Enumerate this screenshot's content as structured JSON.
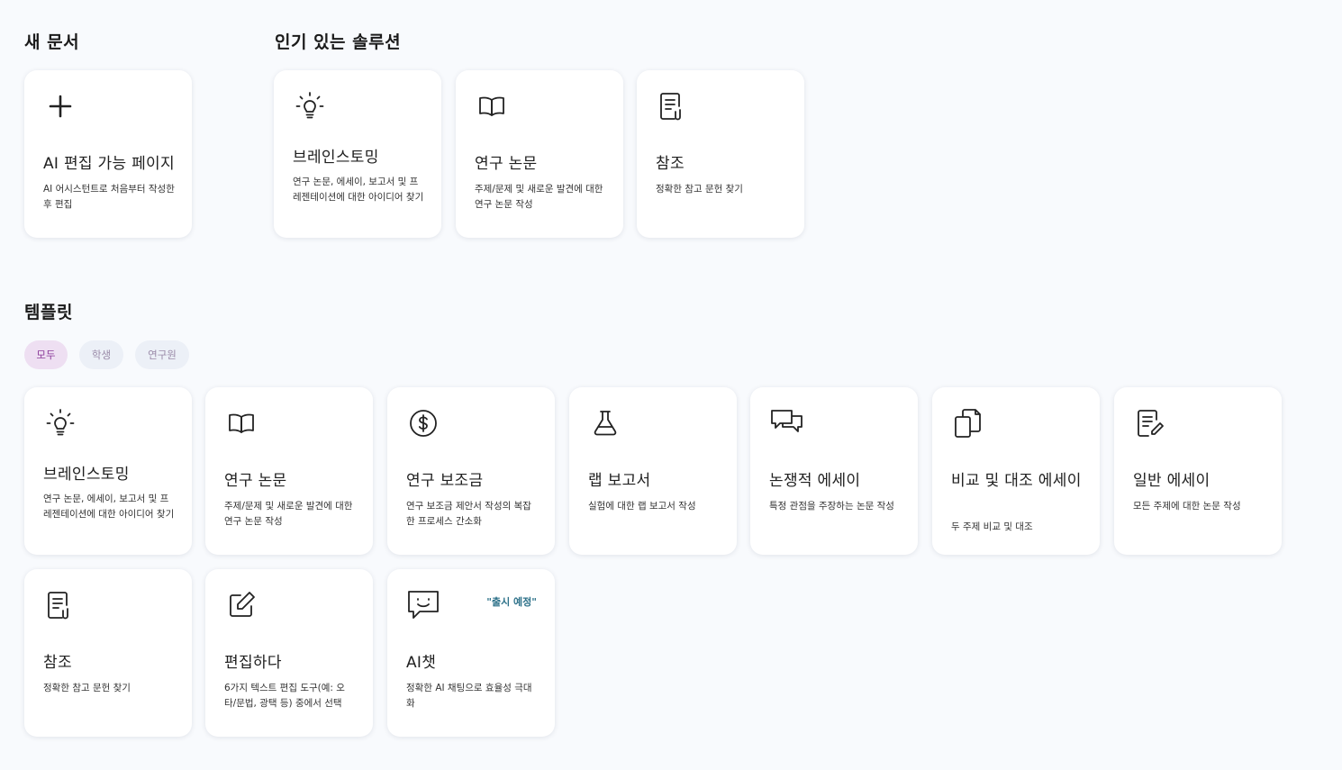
{
  "sections": {
    "new_doc": "새 문서",
    "popular": "인기 있는 솔루션",
    "templates": "템플릿"
  },
  "new_doc_card": {
    "icon": "plus-icon",
    "title": "AI 편집 가능 페이지",
    "desc": "AI 어시스턴트로 처음부터 작성한 후 편집"
  },
  "popular_cards": [
    {
      "icon": "lightbulb-icon",
      "title": "브레인스토밍",
      "desc": "연구 논문, 에세이, 보고서 및 프레젠테이션에 대한 아이디어 찾기"
    },
    {
      "icon": "book-icon",
      "title": "연구 논문",
      "desc": "주제/문제 및 새로운 발견에 대한 연구 논문 작성"
    },
    {
      "icon": "document-clip-icon",
      "title": "참조",
      "desc": "정확한 참고 문헌 찾기"
    }
  ],
  "filters": [
    "모두",
    "학생",
    "연구원"
  ],
  "template_cards": [
    {
      "icon": "lightbulb-icon",
      "title": "브레인스토밍",
      "desc": "연구 논문, 에세이, 보고서 및 프레젠테이션에 대한 아이디어 찾기"
    },
    {
      "icon": "book-icon",
      "title": "연구 논문",
      "desc": "주제/문제 및 새로운 발견에 대한 연구 논문 작성"
    },
    {
      "icon": "dollar-icon",
      "title": "연구 보조금",
      "desc": "연구 보조금 제안서 작성의 복잡한 프로세스 간소화"
    },
    {
      "icon": "flask-icon",
      "title": "랩 보고서",
      "desc": "실험에 대한 랩 보고서 작성"
    },
    {
      "icon": "chat-bubbles-icon",
      "title": "논쟁적 에세이",
      "desc": "특정 관점을 주장하는 논문 작성"
    },
    {
      "icon": "copy-icon",
      "title": "비교 및 대조 에세이",
      "desc": "두 주제 비교 및 대조"
    },
    {
      "icon": "document-edit-icon",
      "title": "일반 에세이",
      "desc": "모든 주제에 대한 논문 작성"
    },
    {
      "icon": "document-clip-icon",
      "title": "참조",
      "desc": "정확한 참고 문헌 찾기"
    },
    {
      "icon": "edit-icon",
      "title": "편집하다",
      "desc": "6가지 텍스트 편집 도구(예: 오타/문법, 광택 등) 중에서 선택"
    },
    {
      "icon": "chat-smile-icon",
      "title": "AI챗",
      "desc": "정확한 AI 채팅으로 효율성 극대화",
      "badge": "\"출시 예정\""
    }
  ]
}
